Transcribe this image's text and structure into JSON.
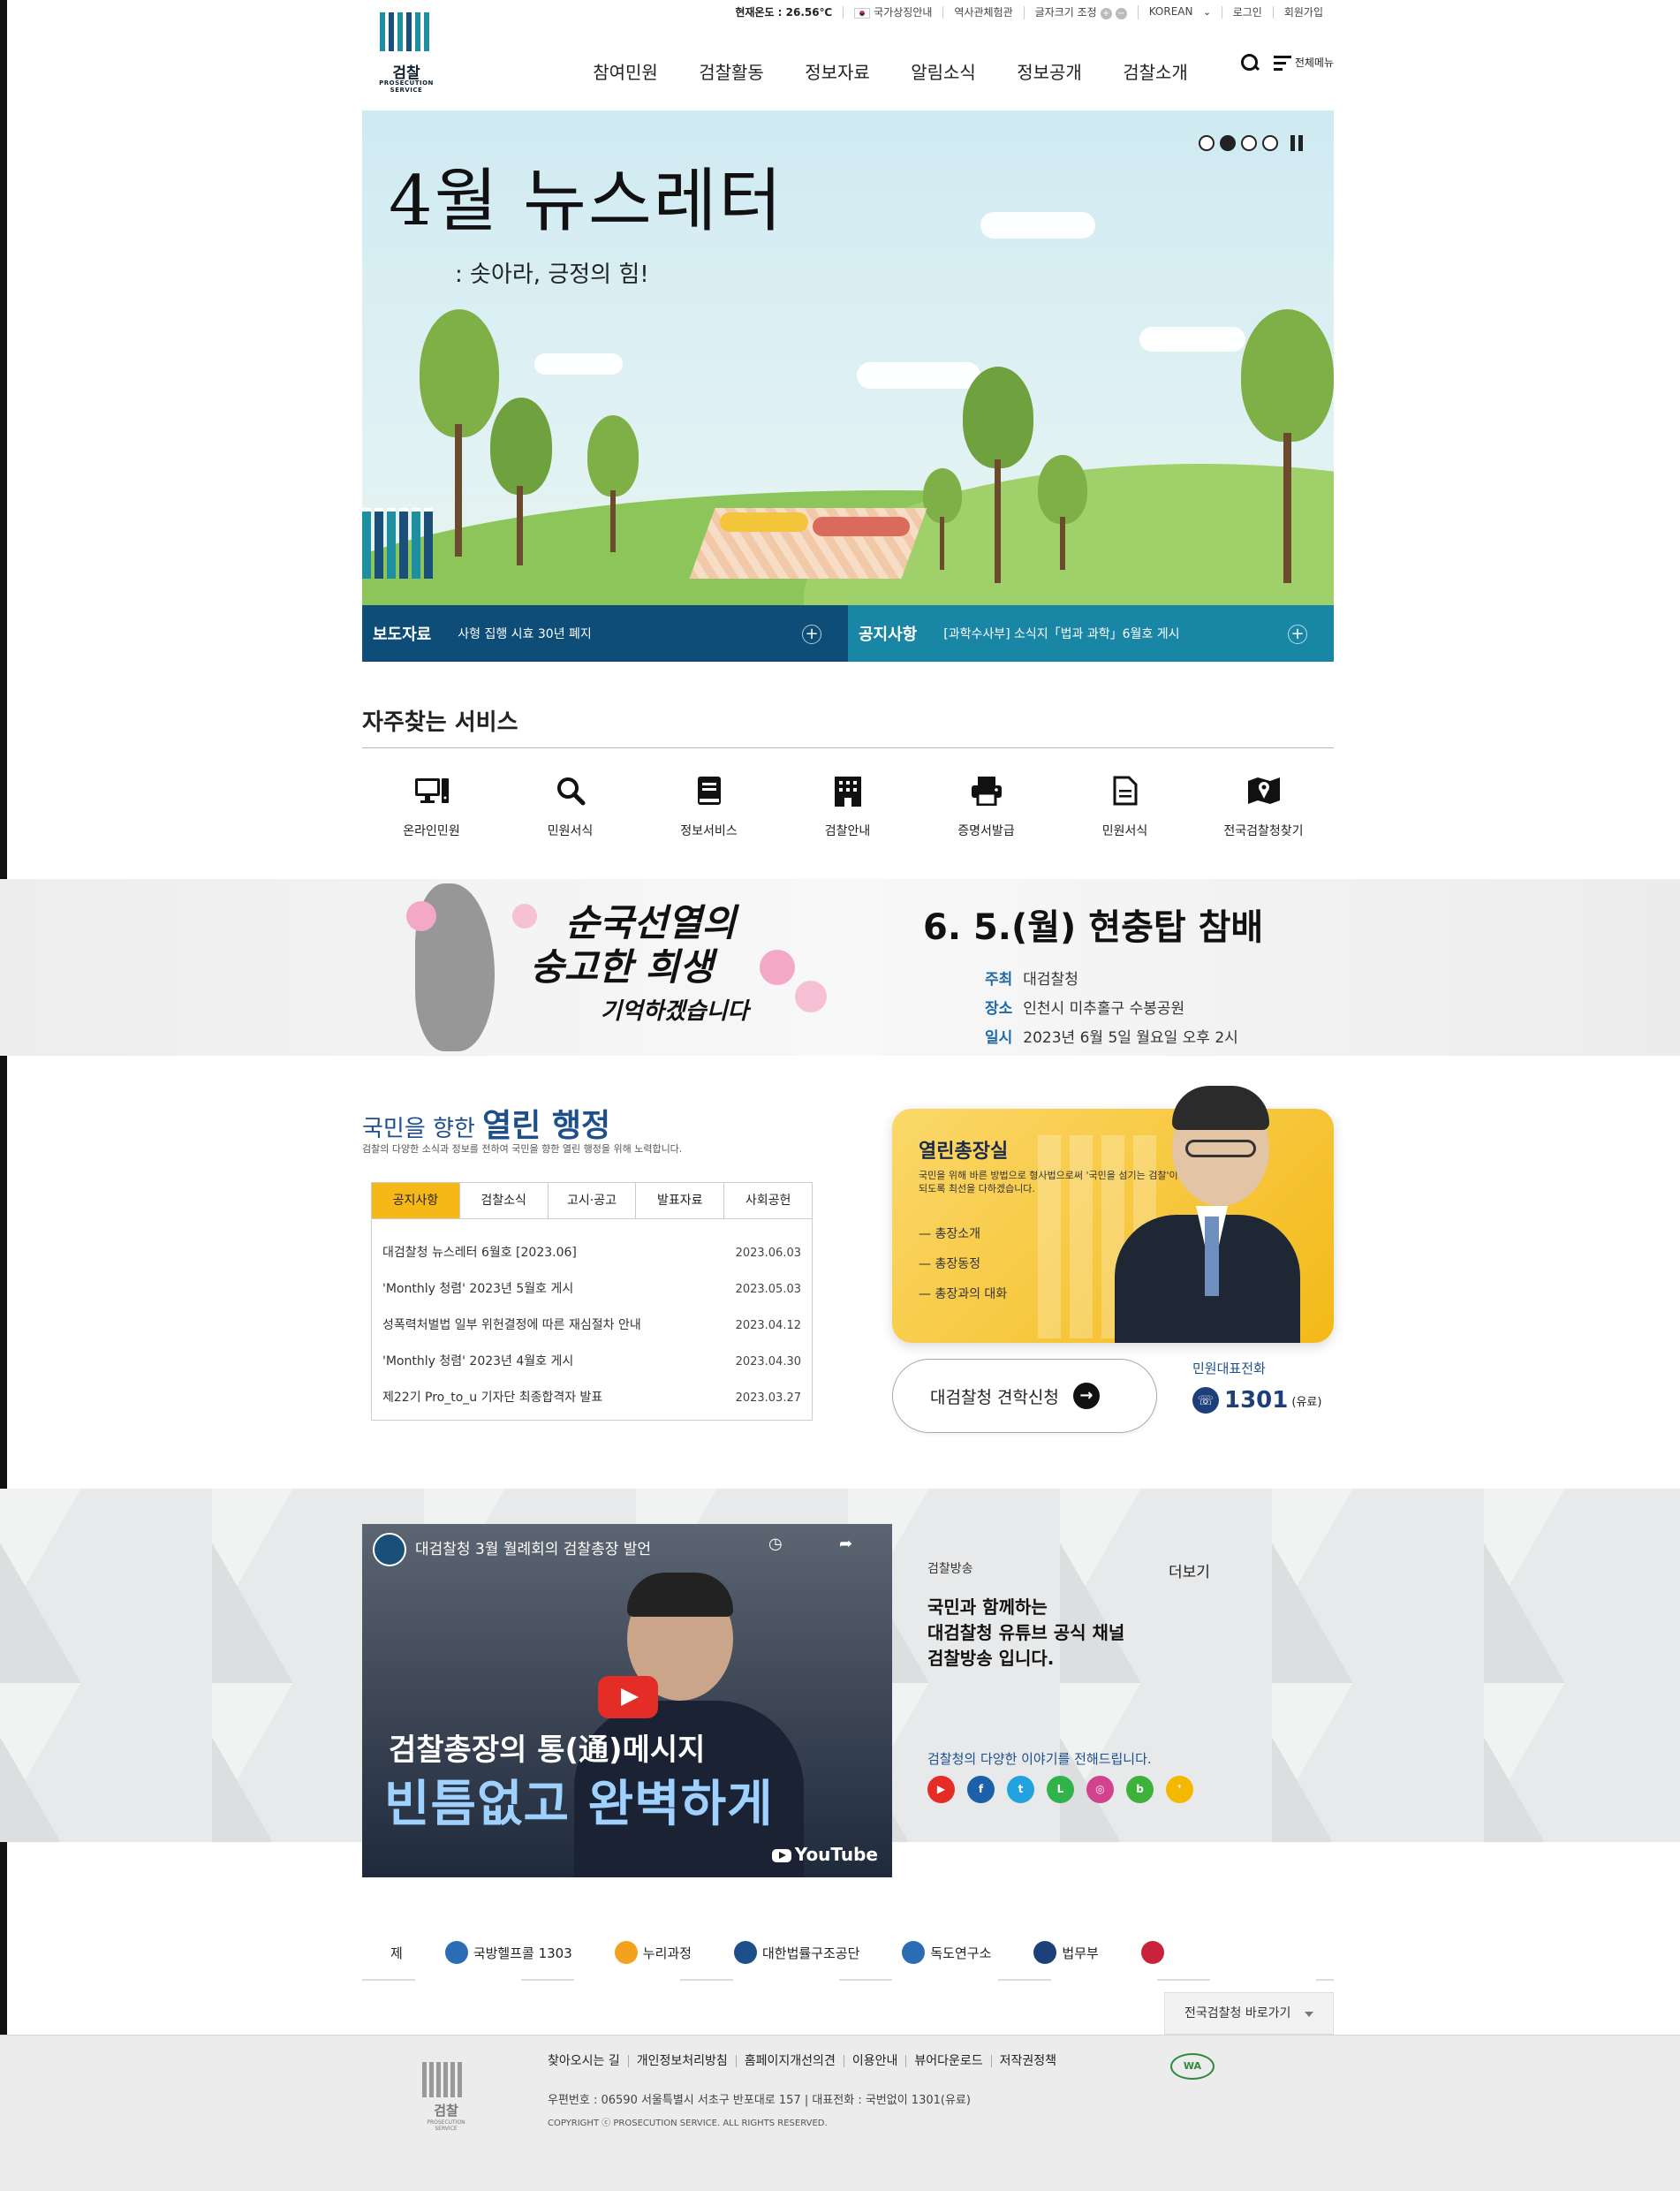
{
  "utility": {
    "temperature": "현재온도 : 26.56℃",
    "national_symbol": "국가상징안내",
    "history": "역사관체험관",
    "font_size": "글자크기 조정",
    "font_plus": "+",
    "font_minus": "−",
    "language": "KOREAN",
    "login": "로그인",
    "signup": "회원가입"
  },
  "logo": {
    "name": "검찰",
    "sub": "PROSECUTION SERVICE"
  },
  "gnb": [
    "참여민원",
    "검찰활동",
    "정보자료",
    "알림소식",
    "정보공개",
    "검찰소개"
  ],
  "header": {
    "all_menu": "전체메뉴"
  },
  "hero": {
    "title": "4월 뉴스레터",
    "subtitle": ": 솟아라, 긍정의 힘!"
  },
  "newsbar": {
    "left_label": "보도자료",
    "left_text": "사형 집행 시효 30년 폐지",
    "right_label": "공지사항",
    "right_text": "[과학수사부] 소식지「법과 과학」6월호 게시"
  },
  "services": {
    "title": "자주찾는 서비스",
    "items": [
      {
        "label": "온라인민원",
        "icon": "computer-icon"
      },
      {
        "label": "민원서식",
        "icon": "search-icon"
      },
      {
        "label": "정보서비스",
        "icon": "book-icon"
      },
      {
        "label": "검찰안내",
        "icon": "building-icon"
      },
      {
        "label": "증명서발급",
        "icon": "printer-icon"
      },
      {
        "label": "민원서식",
        "icon": "document-icon"
      },
      {
        "label": "전국검찰청찾기",
        "icon": "map-icon"
      }
    ]
  },
  "memorial": {
    "calligraphy_1": "순국선열의",
    "calligraphy_2": "숭고한 희생",
    "calligraphy_3": "기억하겠습니다",
    "headline": "6. 5.(월) 현충탑 참배",
    "rows": [
      {
        "k": "주최",
        "v": "대검찰청"
      },
      {
        "k": "장소",
        "v": "인천시 미추홀구 수봉공원"
      },
      {
        "k": "일시",
        "v": "2023년 6월 5일 월요일 오후 2시"
      }
    ]
  },
  "admin": {
    "title_pre": "국민을 향한",
    "title_main": "열린 행정",
    "desc": "검찰의 다양한 소식과 정보를 전하여 국민을 향한 열린 행정을 위해 노력합니다.",
    "tabs": [
      "공지사항",
      "검찰소식",
      "고시·공고",
      "발표자료",
      "사회공헌"
    ],
    "rows": [
      {
        "t": "대검찰청 뉴스레터 6월호 [2023.06]",
        "d": "2023.06.03"
      },
      {
        "t": "'Monthly 청렴' 2023년 5월호 게시",
        "d": "2023.05.03"
      },
      {
        "t": "성폭력처벌법 일부 위헌결정에 따른 재심절차 안내",
        "d": "2023.04.12"
      },
      {
        "t": "'Monthly 청렴' 2023년 4월호 게시",
        "d": "2023.04.30"
      },
      {
        "t": "제22기 Pro_to_u 기자단 최종합격자 발표",
        "d": "2023.03.27"
      }
    ]
  },
  "prosecutor": {
    "title": "열린총장실",
    "desc": "국민을 위해 바른 방법으로 형사법으로써 '국민을 섬기는 검찰'이 되도록 최선을 다하겠습니다.",
    "links": [
      "총장소개",
      "총장동정",
      "총장과의 대화"
    ]
  },
  "visit": {
    "label": "대검찰청 견학신청"
  },
  "phone": {
    "label": "민원대표전화",
    "number": "1301",
    "note": "(유료)"
  },
  "broadcast": {
    "video_title": "대검찰청 3월 월례회의 검찰총장 발언",
    "caption_1": "검찰총장의 통(通)메시지",
    "caption_2": "빈틈없고 완벽하게",
    "youtube": "YouTube",
    "label": "검찰방송",
    "more": "더보기",
    "headline_1": "국민과 함께하는",
    "headline_2": "대검찰청 유튜브 공식 채널",
    "headline_3": "검찰방송 입니다.",
    "desc": "검찰청의 다양한 이야기를 전해드립니다.",
    "sns": [
      {
        "name": "youtube-icon",
        "color": "#e52d27",
        "g": "▶"
      },
      {
        "name": "facebook-icon",
        "color": "#1d5fa8",
        "g": "f"
      },
      {
        "name": "twitter-icon",
        "color": "#23a2e0",
        "g": "t"
      },
      {
        "name": "line-icon",
        "color": "#2fb34a",
        "g": "L"
      },
      {
        "name": "instagram-icon",
        "color": "#d3428c",
        "g": "◎"
      },
      {
        "name": "blog-icon",
        "color": "#3db23a",
        "g": "b"
      },
      {
        "name": "kakao-icon",
        "color": "#f5b800",
        "g": "❜"
      }
    ]
  },
  "related": [
    {
      "label": "제",
      "color": "#ffffff"
    },
    {
      "label": "국방헬프콜 1303",
      "color": "#2a6db5"
    },
    {
      "label": "누리과정",
      "color": "#f2a21c"
    },
    {
      "label": "대한법률구조공단",
      "color": "#1d4f8b"
    },
    {
      "label": "독도연구소",
      "color": "#2a6db5"
    },
    {
      "label": "법무부",
      "color": "#1d3f7a"
    },
    {
      "label": "",
      "color": "#c8233a"
    }
  ],
  "select": {
    "label": "전국검찰청 바로가기"
  },
  "footer": {
    "links": [
      "찾아오시는 길",
      "개인정보처리방침",
      "홈페이지개선의견",
      "이용안내",
      "뷰어다운로드",
      "저작권정책"
    ],
    "address": "우편번호 : 06590 서울특별시 서초구 반포대로 157 | 대표전화 : 국번없이 1301(유료)",
    "copyright": "COPYRIGHT ⓒ PROSECUTION SERVICE. ALL RIGHTS RESERVED.",
    "wa": "WA",
    "logo_name": "검찰",
    "logo_sub": "PROSECUTION SERVICE"
  }
}
